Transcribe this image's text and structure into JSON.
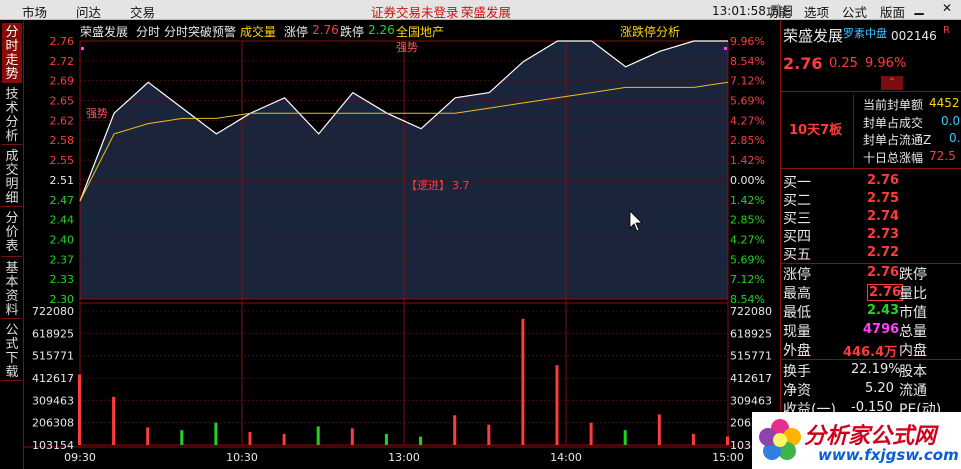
{
  "topbar": {
    "menu_left": [
      "市场",
      "问达",
      "交易"
    ],
    "alert_text": "证券交易未登录",
    "alert_stock": "荣盛发展",
    "clock": "13:01:58 周日",
    "menu_right": [
      "功能",
      "选项",
      "公式",
      "版面"
    ]
  },
  "left_tabs": [
    "分时走势",
    "技术分析",
    "成交明细",
    "分价表",
    "基本资料",
    "公式下载"
  ],
  "header": {
    "stock_name": "荣盛发展",
    "items": [
      "分时",
      "分时突破预警"
    ],
    "volume_label": "成交量",
    "limit_up_label": "涨停",
    "limit_up_value": "2.76",
    "limit_down_label": "跌停",
    "limit_down_value": "2.26",
    "sector": "全国地产",
    "analysis_label": "涨跌停分析"
  },
  "annotations": {
    "signal_1": "强势",
    "signal_2": "强势",
    "watch_label": "【逻进】",
    "watch_value": "3.7"
  },
  "y_axis": {
    "prices": [
      "2.76",
      "2.72",
      "2.69",
      "2.65",
      "2.62",
      "2.58",
      "2.55",
      "2.51",
      "2.47",
      "2.44",
      "2.40",
      "2.37",
      "2.33",
      "2.30"
    ],
    "percents": [
      "9.96%",
      "8.54%",
      "7.12%",
      "5.69%",
      "4.27%",
      "2.85%",
      "1.42%",
      "0.00%",
      "1.42%",
      "2.85%",
      "4.27%",
      "5.69%",
      "7.12%",
      "8.54%"
    ],
    "volumes": [
      "722080",
      "618925",
      "515771",
      "412617",
      "309463",
      "206308",
      "103154"
    ]
  },
  "x_axis": [
    "09:30",
    "10:30",
    "13:00",
    "14:00",
    "15:00"
  ],
  "right_panel": {
    "name": "荣盛发展",
    "tag": "罗素中盘",
    "code": "002146",
    "r_badge": "R",
    "price": "2.76",
    "change": "0.25",
    "change_pct": "9.96%",
    "streak": "10天7板",
    "seal_rows": [
      {
        "label": "当前封单额",
        "value": "4452"
      },
      {
        "label": "封单占成交",
        "value": "0.02"
      },
      {
        "label": "封单占流通Z",
        "value": "0.7"
      },
      {
        "label": "十日总涨幅",
        "value": "72.5"
      }
    ],
    "bids": [
      {
        "label": "买一",
        "price": "2.76"
      },
      {
        "label": "买二",
        "price": "2.75"
      },
      {
        "label": "买三",
        "price": "2.74"
      },
      {
        "label": "买四",
        "price": "2.73"
      },
      {
        "label": "买五",
        "price": "2.72"
      }
    ],
    "stats": [
      {
        "label": "涨停",
        "value": "2.76",
        "label2": "跌停"
      },
      {
        "label": "最高",
        "value": "2.76",
        "label2": "量比"
      },
      {
        "label": "最低",
        "value": "2.43",
        "label2": "市值"
      },
      {
        "label": "现量",
        "value": "4796",
        "label2": "总量"
      },
      {
        "label": "外盘",
        "value": "446.4万",
        "label2": "内盘"
      }
    ],
    "stats2": [
      {
        "label": "换手",
        "value": "22.19%",
        "label2": "股本"
      },
      {
        "label": "净资",
        "value": "5.20",
        "label2": "流通"
      },
      {
        "label": "收益(一)",
        "value": "-0.150",
        "label2": "PE(动)"
      }
    ]
  },
  "logo": {
    "title": "分析家公式网",
    "url": "www.fxjgsw.com"
  },
  "chart_data": {
    "type": "line",
    "prev_close": 2.51,
    "ylim": [
      2.26,
      2.76
    ],
    "x": [
      "09:30",
      "10:30",
      "13:00",
      "14:00",
      "15:00"
    ],
    "series": [
      {
        "values": [
          2.45,
          2.62,
          2.68,
          2.63,
          2.58,
          2.62,
          2.65,
          2.58,
          2.66,
          2.62,
          2.59,
          2.65,
          2.66,
          2.72,
          2.76,
          2.76,
          2.71,
          2.74,
          2.76,
          2.76
        ]
      },
      {
        "values": [
          2.45,
          2.58,
          2.6,
          2.61,
          2.61,
          2.62,
          2.62,
          2.62,
          2.62,
          2.62,
          2.62,
          2.62,
          2.63,
          2.64,
          2.65,
          2.66,
          2.67,
          2.67,
          2.67,
          2.68
        ]
      }
    ],
    "volume": [
      380000,
      260000,
      95000,
      80000,
      120000,
      70000,
      60000,
      100000,
      90000,
      60000,
      45000,
      160000,
      110000,
      680000,
      430000,
      120000,
      80000,
      165000,
      60000,
      45000
    ]
  }
}
